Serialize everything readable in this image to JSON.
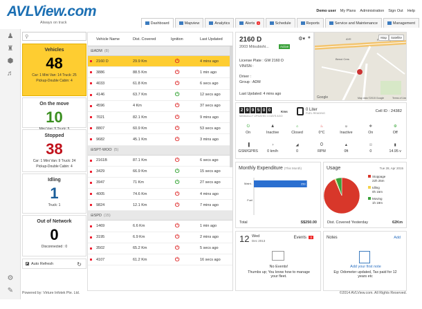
{
  "logo": {
    "text": "AVLView.com",
    "tagline": "Always on track"
  },
  "toplinks": {
    "user": "Demo user",
    "links": [
      "My Plans",
      "Administration",
      "Sign Out",
      "Help"
    ]
  },
  "tabs": [
    {
      "label": "Dashboard",
      "active": true
    },
    {
      "label": "Mapview"
    },
    {
      "label": "Analytics"
    },
    {
      "label": "Alerts",
      "badge": "9"
    },
    {
      "label": "Schedule"
    },
    {
      "label": "Reports"
    },
    {
      "label": "Service and Maintenance"
    },
    {
      "label": "Management"
    }
  ],
  "cards": [
    {
      "title": "Vehicles",
      "count": "48",
      "color": "#000",
      "sub": "Car: 1  Mini Van: 14  Truck: 25",
      "sub2": "Pickup-Double Cabin: 4",
      "selected": true
    },
    {
      "title": "On the move",
      "count": "10",
      "color": "#3a8e1f",
      "sub": "Mini Van: 5   Truck: 5",
      "sub2": ""
    },
    {
      "title": "Stopped",
      "count": "38",
      "color": "#c0111b",
      "sub": "Car: 1  Mini Van: 9  Truck: 24",
      "sub2": "Pickup-Double Cabin: 4"
    },
    {
      "title": "Idling",
      "count": "1",
      "color": "#1a5d99",
      "sub": "Truck: 1",
      "sub2": ""
    },
    {
      "title": "Out of Network",
      "count": "0",
      "color": "#000",
      "sub": "Disconnected : 0",
      "sub2": ""
    }
  ],
  "auto_refresh": "Auto Refresh",
  "table": {
    "headers": [
      "Vehicle Name",
      "Dist. Covered",
      "Ignition",
      "Last Updated"
    ],
    "groups": [
      {
        "name": "ADM",
        "count": "(8)",
        "rows": [
          [
            "2160 D",
            "29.9 Km",
            "off",
            "4 mins ago"
          ],
          [
            "3886",
            "88.5 Km",
            "off",
            "1 min ago"
          ],
          [
            "4033",
            "61.8 Km",
            "off",
            "6 secs ago"
          ],
          [
            "4146",
            "63.7 Km",
            "on",
            "12 secs ago"
          ],
          [
            "4596",
            "4 Km",
            "off",
            "37 secs ago"
          ],
          [
            "7021",
            "82.1 Km",
            "off",
            "9 mins ago"
          ],
          [
            "8807",
            "60.9 Km",
            "off",
            "53 secs ago"
          ],
          [
            "9682",
            "45.1 Km",
            "off",
            "3 mins ago"
          ]
        ]
      },
      {
        "name": "SPT-WOO",
        "count": "(5)",
        "rows": [
          [
            "2161B",
            "87.1 Km",
            "off",
            "6 secs ago"
          ],
          [
            "3429",
            "66.9 Km",
            "on",
            "15 secs ago"
          ],
          [
            "3947",
            "71 Km",
            "on",
            "27 secs ago"
          ],
          [
            "4005",
            "74.6 Km",
            "off",
            "4 mins ago"
          ],
          [
            "9824",
            "12.1 Km",
            "off",
            "7 mins ago"
          ]
        ]
      },
      {
        "name": "SPD",
        "count": "(15)",
        "rows": [
          [
            "1469",
            "6.6 Km",
            "off",
            "1 min ago"
          ],
          [
            "3195",
            "6.9 Km",
            "off",
            "2 mins ago"
          ],
          [
            "3502",
            "65.2 Km",
            "off",
            "5 secs ago"
          ],
          [
            "4107",
            "61.2 Km",
            "off",
            "16 secs ago"
          ]
        ]
      }
    ]
  },
  "vehicle": {
    "reg": "2160 D",
    "model": "2003 Mitsubishi...",
    "status": "Active",
    "license": "License Plate : GW 2160 D",
    "vin": "VIN/SN :",
    "driver": "Driver :",
    "group": "Group : ADM",
    "updated": "Last Updated: 4 mins ago"
  },
  "map": {
    "labels": [
      "Map",
      "Satellite",
      "Pioneer Flyover",
      "AYE",
      "Pioneer Road",
      "Benoi Cres",
      "Google",
      "Map data ©2015 Google",
      "Terms of Use"
    ]
  },
  "odometer": {
    "digits": [
      "2",
      "9",
      "9",
      "5",
      "0",
      "0"
    ],
    "unit": "Kms",
    "sub": "MANUALLY UPDATED 4 DAYS AGO"
  },
  "fuel": {
    "value": "0 Liter",
    "label": "FUEL READING"
  },
  "cell_id": "Cell ID : 24382",
  "status_row1": [
    {
      "icon": "power-icon",
      "label": "On"
    },
    {
      "icon": "seatbelt-icon",
      "label": "Inactive"
    },
    {
      "icon": "door-icon",
      "label": "Closed"
    },
    {
      "icon": "temperature-icon",
      "label": "0°C"
    },
    {
      "icon": "panic-icon",
      "label": "Inactive"
    },
    {
      "icon": "ac-icon",
      "label": "On"
    },
    {
      "icon": "engine-icon",
      "label": "Off"
    }
  ],
  "status_row2": [
    {
      "icon": "signal-icon",
      "label": "GSM/GPRS"
    },
    {
      "icon": "speed-icon",
      "label": "0 km/h"
    },
    {
      "icon": "tilt-icon",
      "label": "0"
    },
    {
      "icon": "rpm-label",
      "label": "RPM",
      "value": "0"
    },
    {
      "icon": "altitude-icon",
      "label": "0ft"
    },
    {
      "icon": "satellite-icon",
      "label": "0"
    },
    {
      "icon": "battery-icon",
      "label": "14.95 v"
    }
  ],
  "expenditure": {
    "title": "Monthly Expenditure",
    "period": "(This Month)",
    "chart_data": {
      "type": "bar",
      "categories": [
        "Maint..",
        "Fuel"
      ],
      "values": [
        250,
        0
      ],
      "xlim": [
        0,
        300
      ]
    },
    "bar_label": "250",
    "total_label": "Total",
    "total": "S$250.00"
  },
  "usage": {
    "title": "Usage",
    "date": "Tue 28, Apr 2015",
    "chart_data": {
      "type": "pie",
      "labels": [
        "Stoppage",
        "Idling",
        "Moving"
      ],
      "durations": [
        "22h 25m",
        "0h 15m",
        "1h 19m"
      ],
      "values": [
        1345,
        15,
        79
      ],
      "colors": [
        "#d8372a",
        "#f5d34b",
        "#3aa13a"
      ]
    },
    "dist_label": "Dist. Covered Yesterday",
    "dist": "62Km"
  },
  "events": {
    "day": "12",
    "weekday": "Wed",
    "monthyear": "Dec 2013",
    "title": "Events",
    "count": "0",
    "empty": "No Events!",
    "msg": "Thumbs up; You know how to manage your fleet."
  },
  "notes": {
    "title": "Notes",
    "add": "Add",
    "link": "Add your first note",
    "example": "Eg: Odometer updated, Tax paid for 12 years etc"
  },
  "footer": {
    "left": "Powered by: Virture Infotek Pte. Ltd.",
    "right": "©2014 AVLView.com. All Rights Reserved."
  }
}
